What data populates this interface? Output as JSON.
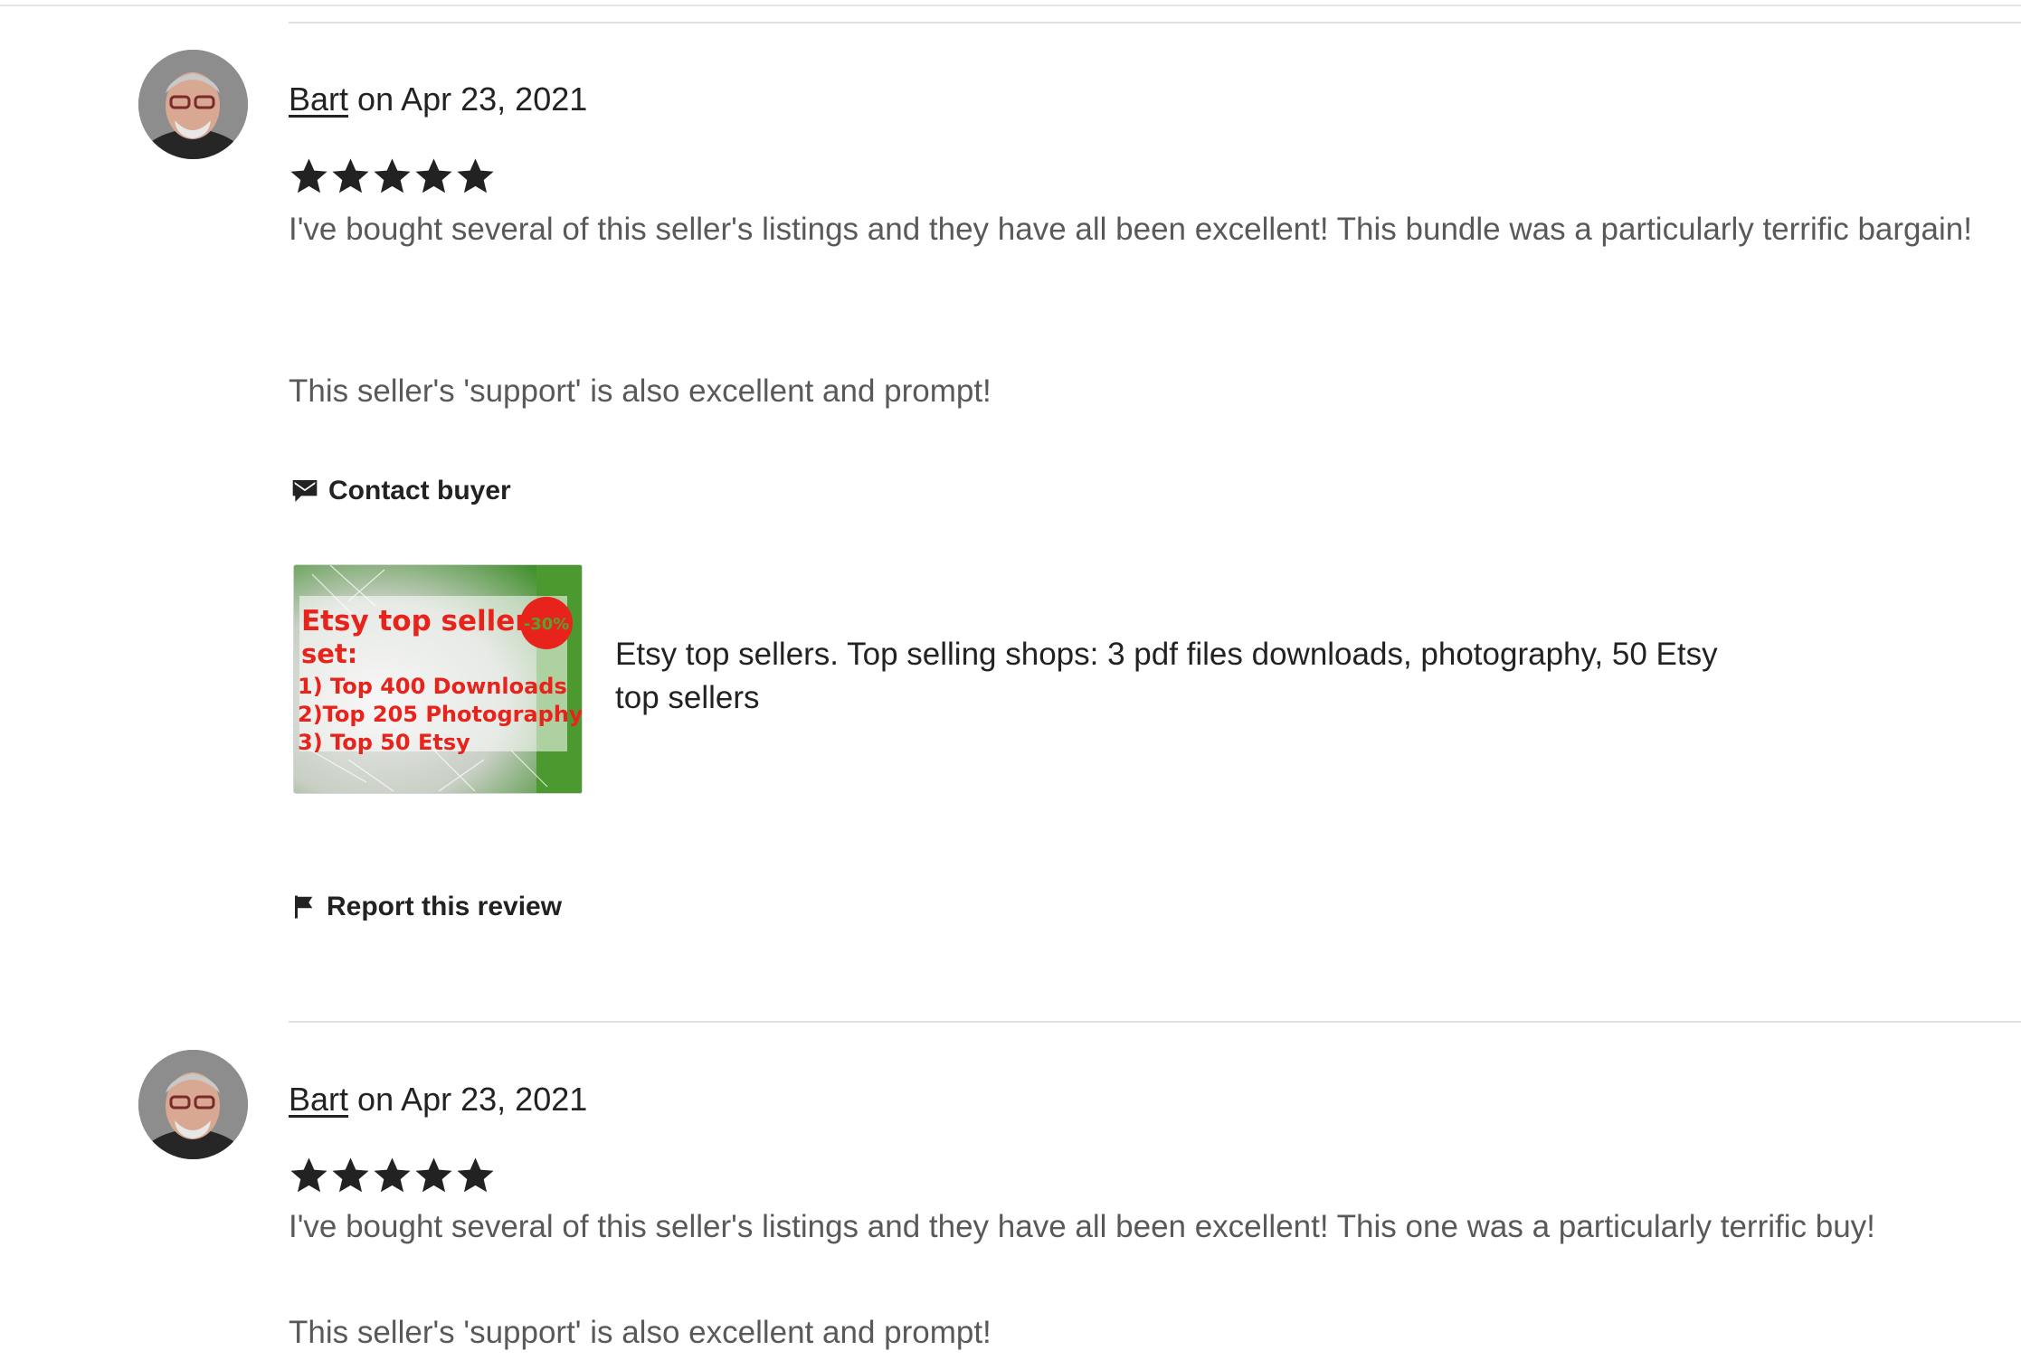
{
  "reviews": [
    {
      "reviewer": "Bart",
      "date_text": "on Apr 23, 2021",
      "rating": 5,
      "paragraphs": [
        "I've bought several of this seller's listings and they have all been excellent! This bundle was a particularly terrific bargain!",
        "This seller's 'support' is also excellent and prompt!"
      ],
      "contact_label": "Contact buyer",
      "listing": {
        "title": "Etsy top sellers. Top selling shops: 3 pdf files downloads, photography, 50 Etsy top sellers",
        "thumbnail_text": {
          "headline_line1": "Etsy top sellers",
          "headline_line2": "set:",
          "discount_badge": "-30%",
          "item1": "1) Top 400 Downloads",
          "item2": "2)Top 205 Photography",
          "item3": "3) Top  50  Etsy"
        }
      },
      "report_label": "Report this review"
    },
    {
      "reviewer": "Bart",
      "date_text": "on Apr 23, 2021",
      "rating": 5,
      "paragraphs": [
        "I've bought several of this seller's listings and they have all been excellent! This one was a particularly terrific buy!",
        "This seller's 'support' is also excellent and prompt!"
      ]
    }
  ],
  "icons": {
    "star": "star-icon",
    "contact": "message-icon",
    "report": "flag-icon",
    "avatar": "avatar"
  },
  "colors": {
    "text": "#222222",
    "muted_text": "#595959",
    "divider": "#e1e1e1",
    "thumb_red": "#e8231c"
  }
}
